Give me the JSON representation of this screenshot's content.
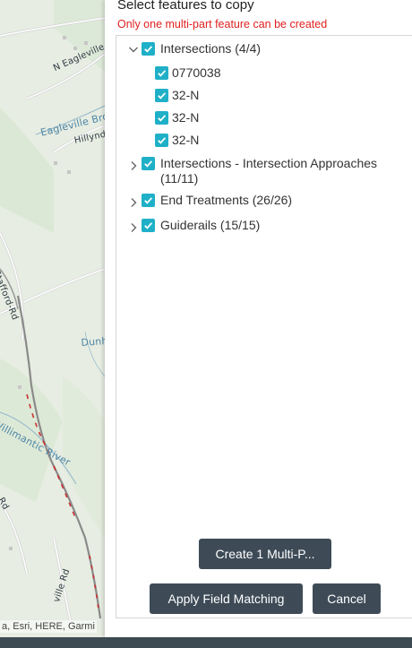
{
  "map": {
    "labels": {
      "road_eagleville": "N Eagleville Ro",
      "brook": "Eagleville Broo",
      "hillyndale": "Hillynd",
      "stafford": "Stafford-Rd",
      "dunham": "Dunh",
      "river": "Willimantic River",
      "rd_left": "o Rd",
      "rd_bottom": "ville Rd"
    },
    "attribution": "a, Esri, HERE, Garmi"
  },
  "panel": {
    "title": "Select features to copy",
    "warning": "Only one multi-part feature can be created",
    "tree": [
      {
        "label": "Intersections (4/4)",
        "expanded": true,
        "checked": true
      },
      {
        "label": "0770038",
        "checked": true
      },
      {
        "label": "32-N",
        "checked": true
      },
      {
        "label": "32-N",
        "checked": true
      },
      {
        "label": "32-N",
        "checked": true
      },
      {
        "label_line1": "Intersections - Intersection Approaches",
        "label_line2": "(11/11)",
        "expanded": false,
        "checked": true
      },
      {
        "label": "End Treatments (26/26)",
        "expanded": false,
        "checked": true
      },
      {
        "label": "Guiderails (15/15)",
        "expanded": false,
        "checked": true
      }
    ],
    "buttons": {
      "create": "Create 1 Multi-P...",
      "apply": "Apply Field Matching",
      "cancel": "Cancel"
    }
  },
  "colors": {
    "accent_checkbox": "#1fb0c8",
    "button_bg": "#3e4b57",
    "warning": "#e02020"
  }
}
